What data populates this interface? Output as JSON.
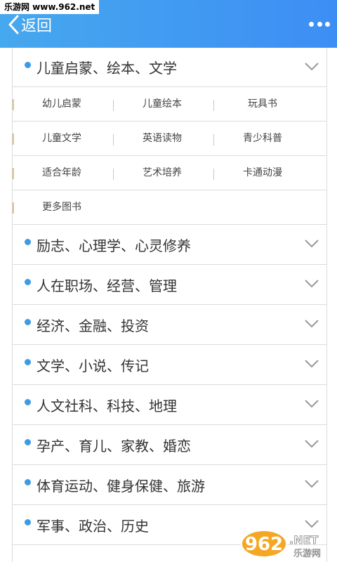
{
  "watermark": "乐游网 www.962.net",
  "header": {
    "back_label": "返回",
    "back_icon": "chevron-left-icon",
    "more_icon": "more-dots-icon"
  },
  "categories": [
    {
      "label": "儿童启蒙、绘本、文学",
      "expanded": true
    },
    {
      "label": "励志、心理学、心灵修养",
      "expanded": false
    },
    {
      "label": "人在职场、经营、管理",
      "expanded": false
    },
    {
      "label": "经济、金融、投资",
      "expanded": false
    },
    {
      "label": "文学、小说、传记",
      "expanded": false
    },
    {
      "label": "人文社科、科技、地理",
      "expanded": false
    },
    {
      "label": "孕产、育儿、家教、婚恋",
      "expanded": false
    },
    {
      "label": "体育运动、健身保健、旅游",
      "expanded": false
    },
    {
      "label": "军事、政治、历史",
      "expanded": false
    }
  ],
  "subcategories": [
    [
      "幼儿启蒙",
      "儿童绘本",
      "玩具书"
    ],
    [
      "儿童文学",
      "英语读物",
      "青少科普"
    ],
    [
      "适合年龄",
      "艺术培养",
      "卡通动漫"
    ],
    [
      "更多图书"
    ]
  ],
  "logo": {
    "number": "962",
    "suffix": ".NET",
    "sub": "乐游网"
  },
  "colors": {
    "header_start": "#46a8ee",
    "header_end": "#3d8ef4",
    "dot": "#3a9be6",
    "border": "#dcdcdc"
  }
}
